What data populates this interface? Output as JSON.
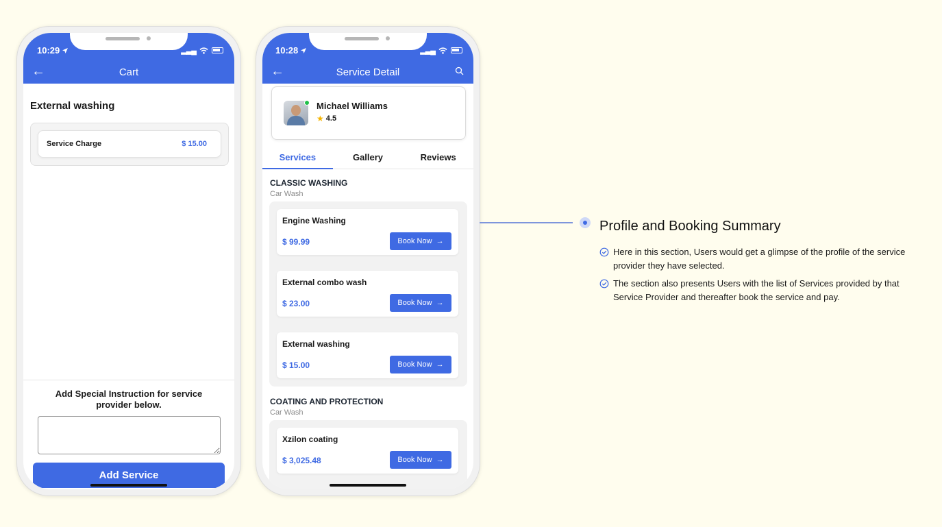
{
  "cart_screen": {
    "status_time": "10:29",
    "nav_title": "Cart",
    "section_title": "External washing",
    "charge_label": "Service Charge",
    "charge_value": "$ 15.00",
    "instruction_label": "Add Special Instruction for service provider below.",
    "instruction_value": "",
    "add_button": "Add Service"
  },
  "detail_screen": {
    "status_time": "10:28",
    "nav_title": "Service Detail",
    "provider_name": "Michael Williams",
    "rating": "4.5",
    "tabs": [
      "Services",
      "Gallery",
      "Reviews"
    ],
    "active_tab": "Services",
    "book_label": "Book Now",
    "categories": [
      {
        "title": "CLASSIC WASHING",
        "subtitle": "Car Wash",
        "services": [
          {
            "name": "Engine Washing",
            "price": "$ 99.99"
          },
          {
            "name": "External combo wash",
            "price": "$ 23.00"
          },
          {
            "name": "External washing",
            "price": "$ 15.00"
          }
        ]
      },
      {
        "title": "COATING AND PROTECTION",
        "subtitle": "Car Wash",
        "services": [
          {
            "name": "Xzilon coating",
            "price": "$ 3,025.48"
          }
        ]
      }
    ]
  },
  "callout": {
    "title": "Profile and Booking Summary",
    "points": [
      "Here in this section, Users would get a glimpse of the profile of the service provider they have selected.",
      "The section also presents Users with the list of Services provided by that Service Provider and thereafter book the service and pay."
    ]
  },
  "colors": {
    "accent": "#3f6ae3",
    "background": "#fffdee",
    "star": "#f5b400",
    "online": "#1fbf4a"
  },
  "icons": [
    "location-arrow-icon",
    "wifi-icon",
    "battery-icon",
    "back-arrow-icon",
    "search-icon",
    "star-icon",
    "arrow-right-icon",
    "check-circle-icon"
  ]
}
